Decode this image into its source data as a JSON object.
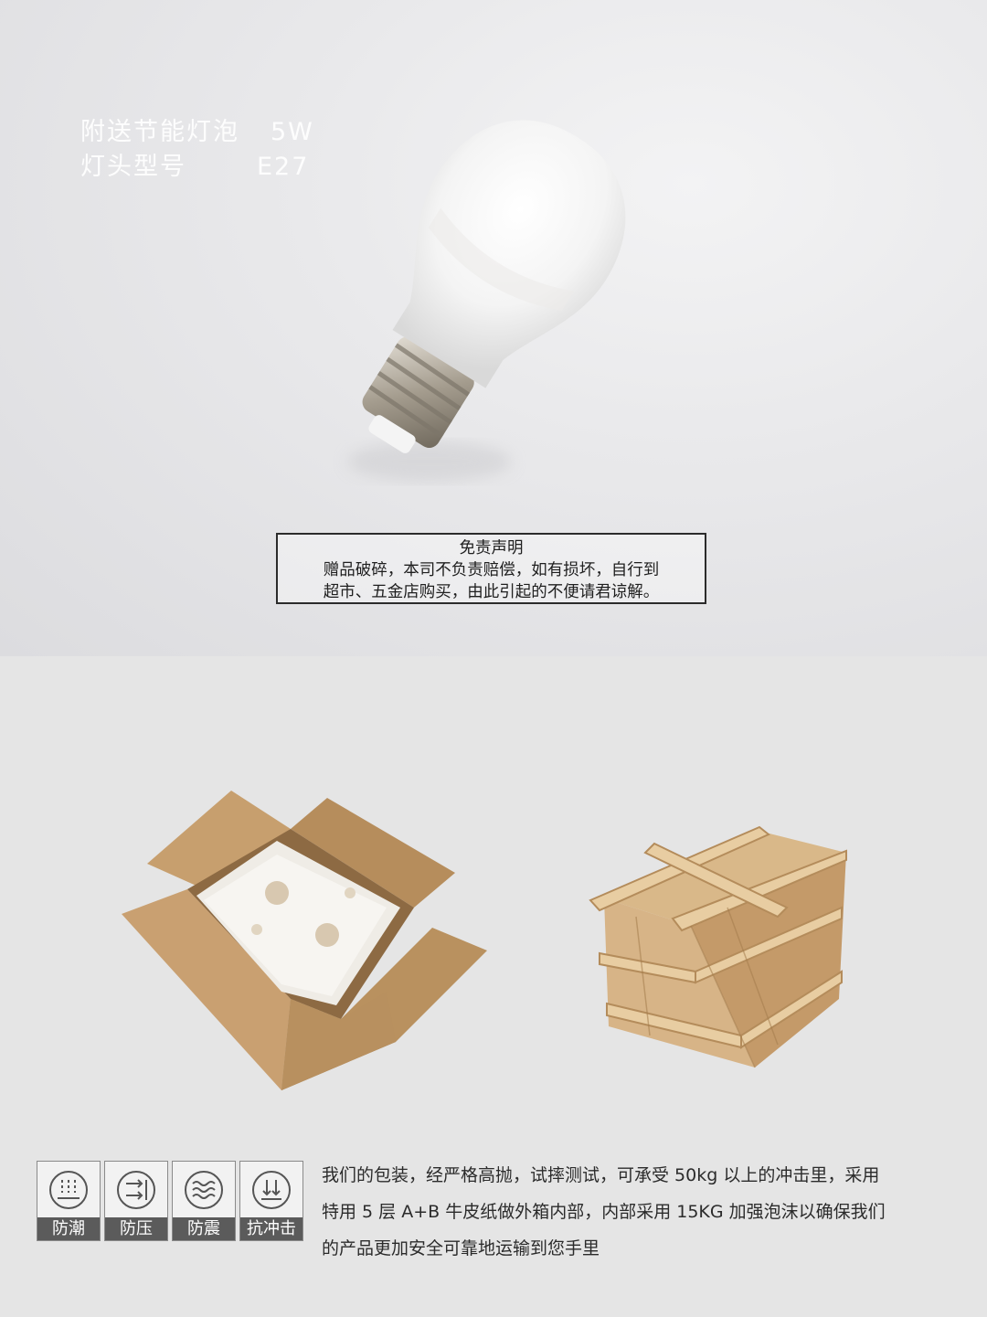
{
  "product": {
    "spec_rows": [
      {
        "label": "附送节能灯泡",
        "value": "5W"
      },
      {
        "label": "灯头型号",
        "value": "E27"
      }
    ]
  },
  "disclaimer": {
    "title": "免责声明",
    "lines": [
      "赠品破碎，本司不负责赔偿，如有损坏，自行到",
      "超市、五金店购买，由此引起的不便请君谅解。"
    ]
  },
  "packaging": {
    "features": [
      "防潮",
      "防压",
      "防震",
      "抗冲击"
    ],
    "description_lines": [
      "我们的包装，经严格高抛，试摔测试，可承受 50kg 以上的冲击里，采用",
      "特用 5 层 A+B 牛皮纸做外箱内部，内部采用 15KG 加强泡沫以确保我们",
      "的产品更加安全可靠地运输到您手里"
    ]
  }
}
